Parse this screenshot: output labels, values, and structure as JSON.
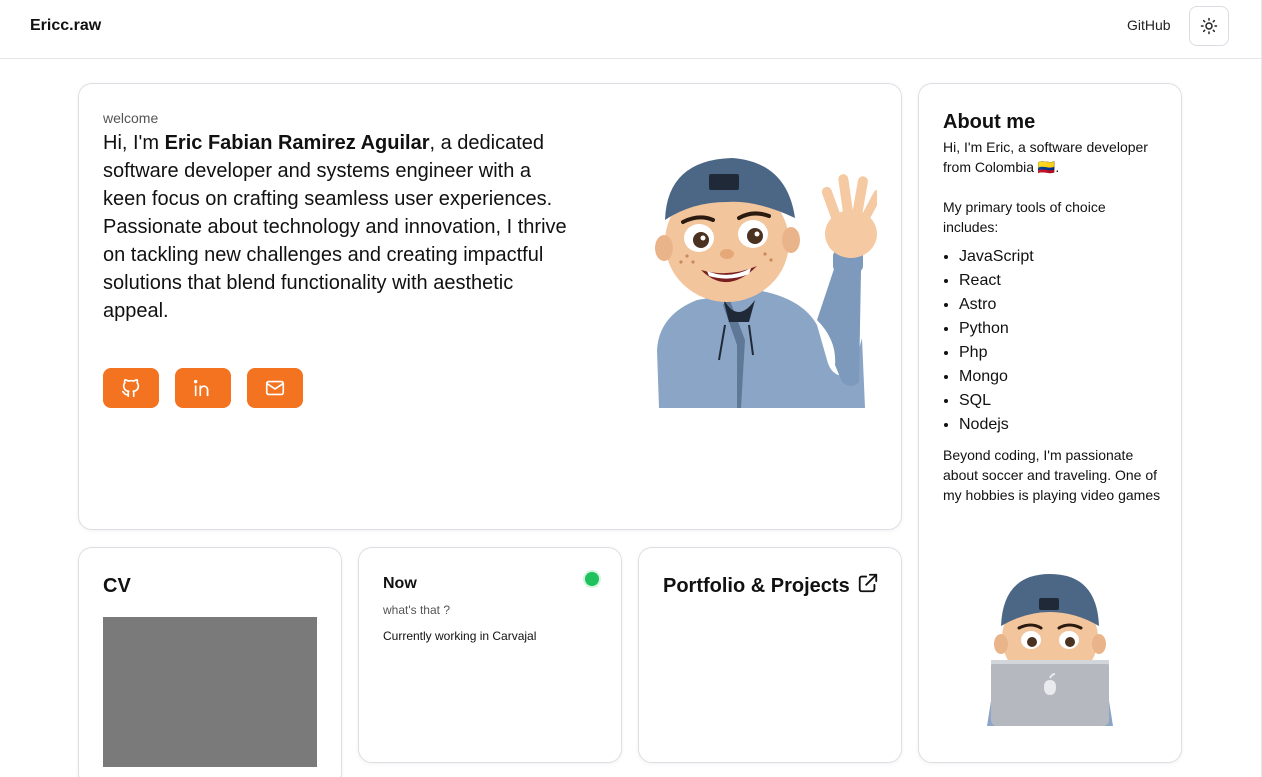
{
  "header": {
    "brand": "Ericc.raw",
    "nav_link": "GitHub",
    "theme_toggle_icon": "sun-icon"
  },
  "hero": {
    "eyebrow": "welcome",
    "intro_prefix": "Hi, I'm ",
    "name": "Eric Fabian Ramirez Aguilar",
    "intro_body": ", a dedicated software developer and systems engineer with a keen focus on crafting seamless user experiences. Passionate about technology and innovation, I thrive on tackling new challenges and creating impactful solutions that blend functionality with aesthetic appeal.",
    "social_links": [
      {
        "icon": "github-icon"
      },
      {
        "icon": "linkedin-icon"
      },
      {
        "icon": "mail-icon"
      }
    ],
    "accent_color": "#f47321",
    "illustration": "waving-memoji-avatar"
  },
  "about": {
    "title": "About me",
    "intro": "Hi, I'm Eric, a software developer from Colombia 🇨🇴.",
    "tools_intro": "My primary tools of choice includes:",
    "tools": [
      "JavaScript",
      "React",
      "Astro",
      "Python",
      "Php",
      "Mongo",
      "SQL",
      "Nodejs"
    ],
    "hobbies": "Beyond coding, I'm passionate about soccer and traveling. One of my hobbies is playing video games",
    "illustration": "laptop-memoji-avatar"
  },
  "cv": {
    "title": "CV",
    "preview_color": "#7a7a7a"
  },
  "now": {
    "title": "Now",
    "subtitle": "what's that ?",
    "status": "Currently working in Carvajal",
    "status_color": "#1fc15c"
  },
  "portfolio": {
    "title": "Portfolio & Projects",
    "link_icon": "external-link-icon"
  }
}
